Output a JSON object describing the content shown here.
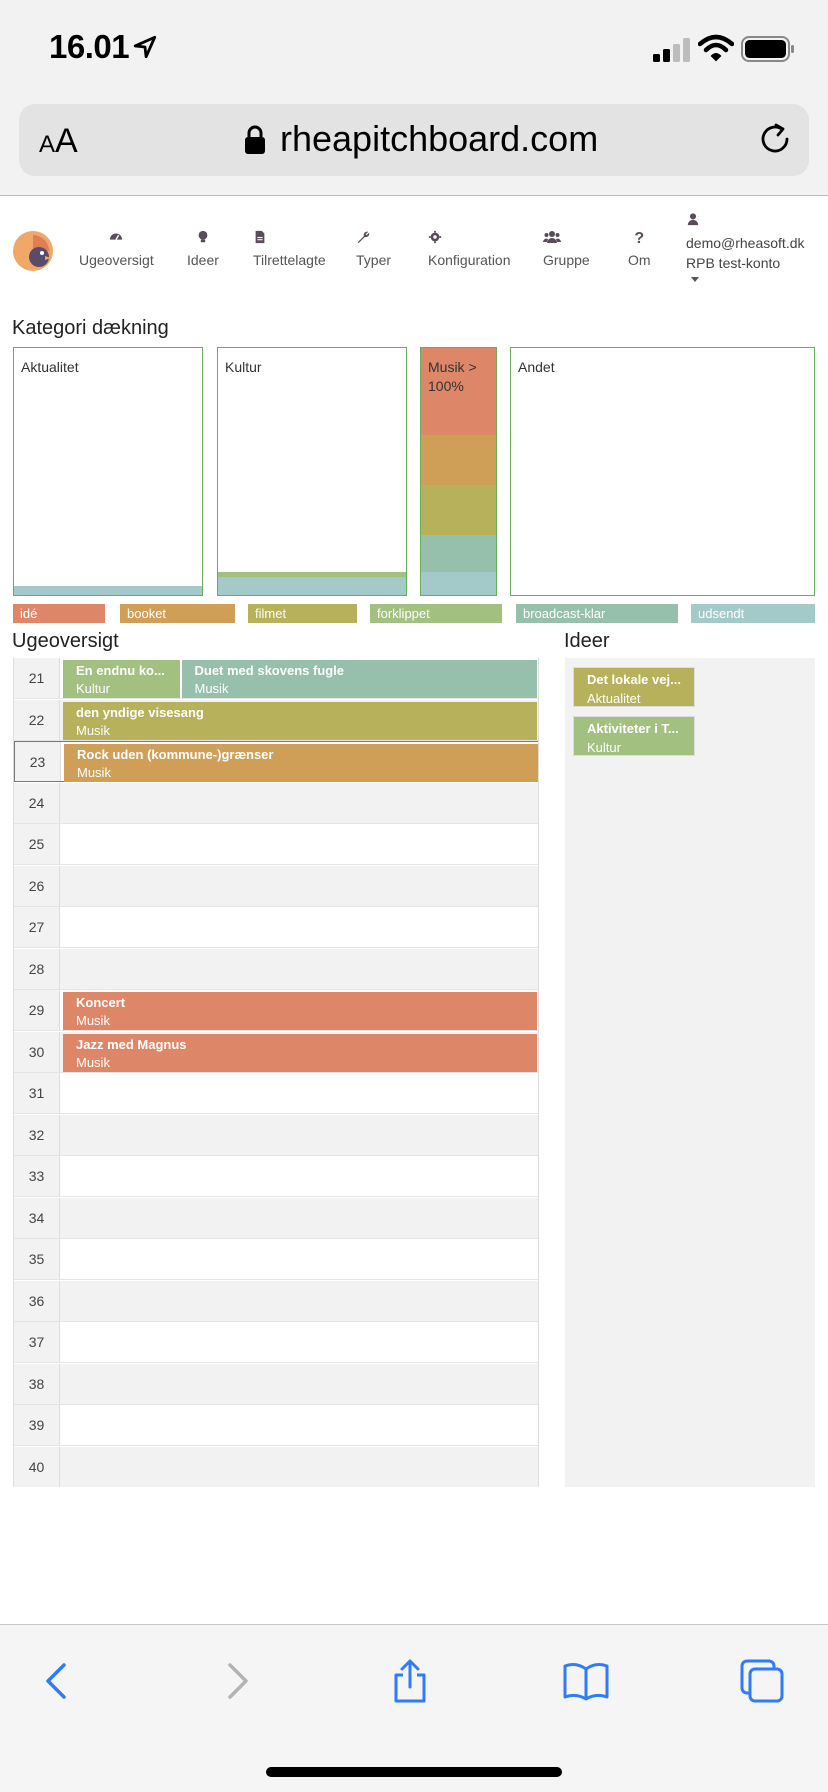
{
  "status_bar": {
    "time": "16.01"
  },
  "browser": {
    "aa_label_small": "A",
    "aa_label_large": "A",
    "url": "rheapitchboard.com"
  },
  "nav": {
    "items": [
      {
        "label": "Ugeoversigt",
        "icon": "dashboard-icon"
      },
      {
        "label": "Ideer",
        "icon": "lightbulb-icon"
      },
      {
        "label": "Tilrettelagte",
        "icon": "document-icon"
      },
      {
        "label": "Typer",
        "icon": "wrench-icon"
      },
      {
        "label": "Konfiguration",
        "icon": "gear-icon"
      },
      {
        "label": "Gruppe",
        "icon": "users-icon"
      },
      {
        "label": "Om",
        "icon": "question-icon"
      }
    ],
    "user_email": "demo@rheasoft.dk",
    "account": "RPB test-konto"
  },
  "coverage": {
    "title": "Kategori dækning",
    "categories": [
      {
        "label": "Aktualitet"
      },
      {
        "label": "Kultur"
      },
      {
        "label": "Musik > 100%"
      },
      {
        "label": "Andet"
      }
    ]
  },
  "statuses": [
    {
      "label": "idé",
      "color": "#de8768"
    },
    {
      "label": "booket",
      "color": "#cf9f58"
    },
    {
      "label": "filmet",
      "color": "#b6b15a"
    },
    {
      "label": "forklippet",
      "color": "#a2c07f"
    },
    {
      "label": "broadcast-klar",
      "color": "#96c0ab"
    },
    {
      "label": "udsendt",
      "color": "#a3c9c9"
    }
  ],
  "weekly": {
    "title": "Ugeoversigt",
    "weeks": [
      "21",
      "22",
      "23",
      "24",
      "25",
      "26",
      "27",
      "28",
      "29",
      "30",
      "31",
      "32",
      "33",
      "34",
      "35",
      "36",
      "37",
      "38",
      "39",
      "40"
    ],
    "entries": [
      {
        "week": "21",
        "title": "En endnu ko...",
        "category": "Kultur",
        "status": "forklippet"
      },
      {
        "week": "21",
        "title": "Duet med skovens fugle",
        "category": "Musik",
        "status": "broadcast-klar"
      },
      {
        "week": "22",
        "title": "den yndige visesang",
        "category": "Musik",
        "status": "filmet"
      },
      {
        "week": "23",
        "title": "Rock uden (kommune-)grænser",
        "category": "Musik",
        "status": "booket"
      },
      {
        "week": "29",
        "title": "Koncert",
        "category": "Musik",
        "status": "idé"
      },
      {
        "week": "30",
        "title": "Jazz med Magnus",
        "category": "Musik",
        "status": "idé"
      }
    ]
  },
  "ideas": {
    "title": "Ideer",
    "items": [
      {
        "title": "Det lokale vej...",
        "category": "Aktualitet",
        "status": "filmet"
      },
      {
        "title": "Aktiviteter i T...",
        "category": "Kultur",
        "status": "forklippet"
      }
    ]
  }
}
